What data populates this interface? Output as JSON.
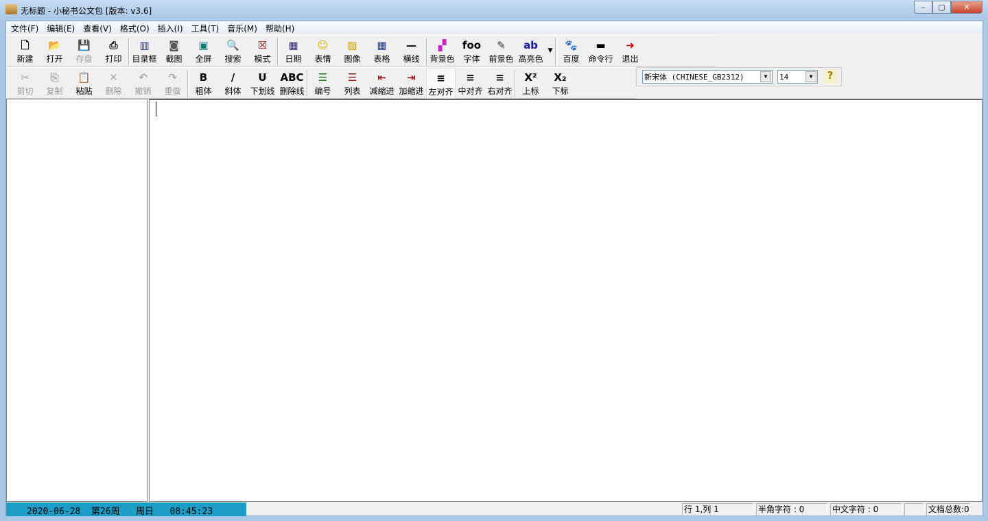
{
  "window": {
    "title": "无标题 - 小秘书公文包  [版本: v3.6]",
    "min": "–",
    "max": "▢",
    "close": "✕"
  },
  "menu": [
    "文件(F)",
    "编辑(E)",
    "查看(V)",
    "格式(O)",
    "插入(I)",
    "工具(T)",
    "音乐(M)",
    "帮助(H)"
  ],
  "toolbar1": [
    {
      "label": "新建",
      "icon": "new-file-icon",
      "glyph": "🗋",
      "color": "#000"
    },
    {
      "label": "打开",
      "icon": "open-folder-icon",
      "glyph": "📂",
      "color": "#b08a20"
    },
    {
      "label": "存盘",
      "icon": "save-icon",
      "glyph": "💾",
      "color": "#888",
      "disabled": true
    },
    {
      "label": "打印",
      "icon": "printer-icon",
      "glyph": "⎙",
      "color": "#000"
    },
    {
      "sep": true
    },
    {
      "label": "目录框",
      "icon": "directory-panel-icon",
      "glyph": "▥",
      "color": "#1a3aa8"
    },
    {
      "label": "截图",
      "icon": "screenshot-icon",
      "glyph": "◙",
      "color": "#555"
    },
    {
      "label": "全屏",
      "icon": "fullscreen-icon",
      "glyph": "▣",
      "color": "#0a7a7a"
    },
    {
      "label": "搜索",
      "icon": "search-icon",
      "glyph": "🔍",
      "color": "#0a4aa8"
    },
    {
      "label": "模式",
      "icon": "mode-icon",
      "glyph": "☒",
      "color": "#c00"
    },
    {
      "sep": true
    },
    {
      "label": "日期",
      "icon": "calendar-icon",
      "glyph": "▦",
      "color": "#3a2a70"
    },
    {
      "label": "表情",
      "icon": "smiley-icon",
      "glyph": "☺",
      "color": "#d8b000"
    },
    {
      "label": "图像",
      "icon": "image-icon",
      "glyph": "▨",
      "color": "#c8a000"
    },
    {
      "label": "表格",
      "icon": "table-icon",
      "glyph": "▦",
      "color": "#1a3aa8"
    },
    {
      "label": "横线",
      "icon": "horizontal-line-icon",
      "glyph": "—",
      "color": "#000"
    },
    {
      "sep": true
    },
    {
      "label": "背景色",
      "icon": "background-color-icon",
      "glyph": "▞",
      "color": "#d020d0"
    },
    {
      "label": "字体",
      "icon": "font-icon",
      "glyph": "foo",
      "color": "#000"
    },
    {
      "label": "前景色",
      "icon": "foreground-color-icon",
      "glyph": "✎",
      "color": "#333"
    },
    {
      "label": "高亮色",
      "icon": "highlight-color-icon",
      "glyph": "ab",
      "color": "#1a1aa8"
    },
    {
      "dropdown": true,
      "glyph": "▼"
    },
    {
      "sep": true
    },
    {
      "label": "百度",
      "icon": "baidu-paw-icon",
      "glyph": "🐾",
      "color": "#1a3ad8"
    },
    {
      "label": "命令行",
      "icon": "command-line-icon",
      "glyph": "▬",
      "color": "#000"
    },
    {
      "label": "退出",
      "icon": "exit-icon",
      "glyph": "➜",
      "color": "#d00"
    }
  ],
  "toolbar2": [
    {
      "label": "剪切",
      "icon": "cut-icon",
      "glyph": "✂",
      "color": "#888",
      "disabled": true
    },
    {
      "label": "复制",
      "icon": "copy-icon",
      "glyph": "⎘",
      "color": "#888",
      "disabled": true
    },
    {
      "label": "粘贴",
      "icon": "paste-icon",
      "glyph": "📋",
      "color": "#555"
    },
    {
      "label": "删除",
      "icon": "delete-icon",
      "glyph": "✕",
      "color": "#888",
      "disabled": true
    },
    {
      "label": "撤销",
      "icon": "undo-icon",
      "glyph": "↶",
      "color": "#888",
      "disabled": true
    },
    {
      "label": "重做",
      "icon": "redo-icon",
      "glyph": "↷",
      "color": "#888",
      "disabled": true
    },
    {
      "sep": true
    },
    {
      "label": "粗体",
      "icon": "bold-icon",
      "glyph": "B",
      "color": "#000"
    },
    {
      "label": "斜体",
      "icon": "italic-icon",
      "glyph": "/",
      "color": "#000"
    },
    {
      "label": "下划线",
      "icon": "underline-icon",
      "glyph": "U",
      "color": "#000"
    },
    {
      "label": "删除线",
      "icon": "strikethrough-icon",
      "glyph": "ABC",
      "color": "#000"
    },
    {
      "sep": true
    },
    {
      "label": "编号",
      "icon": "numbered-list-icon",
      "glyph": "☰",
      "color": "#1a7a1a"
    },
    {
      "label": "列表",
      "icon": "bullet-list-icon",
      "glyph": "☰",
      "color": "#a01a1a"
    },
    {
      "label": "减缩进",
      "icon": "decrease-indent-icon",
      "glyph": "⇤",
      "color": "#a01a1a"
    },
    {
      "label": "加缩进",
      "icon": "increase-indent-icon",
      "glyph": "⇥",
      "color": "#a01a1a"
    },
    {
      "label": "左对齐",
      "icon": "align-left-icon",
      "glyph": "≡",
      "color": "#000",
      "pressed": true
    },
    {
      "label": "中对齐",
      "icon": "align-center-icon",
      "glyph": "≡",
      "color": "#000"
    },
    {
      "label": "右对齐",
      "icon": "align-right-icon",
      "glyph": "≡",
      "color": "#000"
    },
    {
      "sep": true
    },
    {
      "label": "上标",
      "icon": "superscript-icon",
      "glyph": "X²",
      "color": "#000"
    },
    {
      "label": "下标",
      "icon": "subscript-icon",
      "glyph": "X₂",
      "color": "#000"
    }
  ],
  "fontbar": {
    "font": "新宋体 (CHINESE_GB2312)",
    "size": "14",
    "help": "?"
  },
  "status": {
    "clock": "2020-06-28  第26周   周日   08:45:23",
    "position": "行 1,列 1",
    "half_width": "半角字符 : 0",
    "chinese": "中文字符 : 0",
    "blank": "",
    "doc_count": "文档总数:0"
  }
}
